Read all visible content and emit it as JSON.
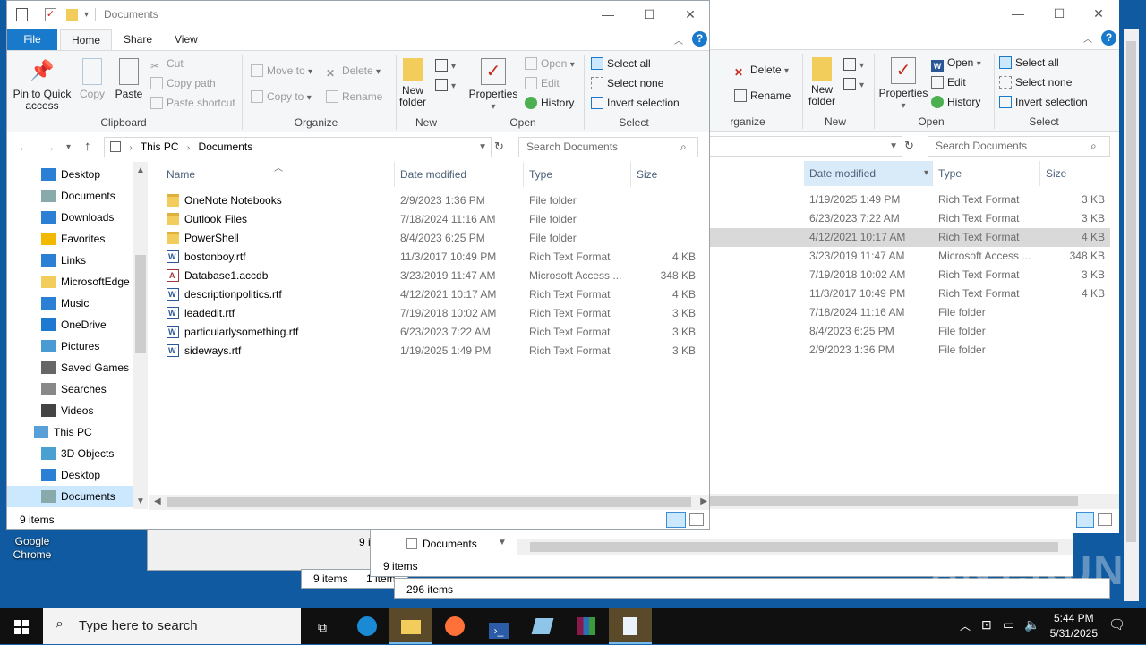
{
  "desktop": {
    "icon_label": "Google Chrome"
  },
  "front": {
    "title": "Documents",
    "tabs": {
      "file": "File",
      "home": "Home",
      "share": "Share",
      "view": "View"
    },
    "ribbon": {
      "pin": "Pin to Quick access",
      "copy": "Copy",
      "paste": "Paste",
      "cut": "Cut",
      "copy_path": "Copy path",
      "paste_shortcut": "Paste shortcut",
      "clipboard": "Clipboard",
      "move_to": "Move to",
      "copy_to": "Copy to",
      "delete": "Delete",
      "rename": "Rename",
      "organize": "Organize",
      "new_folder": "New folder",
      "new": "New",
      "properties": "Properties",
      "open": "Open",
      "edit": "Edit",
      "history": "History",
      "open_group": "Open",
      "select_all": "Select all",
      "select_none": "Select none",
      "invert_selection": "Invert selection",
      "select_group": "Select"
    },
    "breadcrumb": {
      "root": "This PC",
      "current": "Documents"
    },
    "search_placeholder": "Search Documents",
    "nav": [
      {
        "label": "Desktop"
      },
      {
        "label": "Documents"
      },
      {
        "label": "Downloads"
      },
      {
        "label": "Favorites"
      },
      {
        "label": "Links"
      },
      {
        "label": "MicrosoftEdge"
      },
      {
        "label": "Music"
      },
      {
        "label": "OneDrive"
      },
      {
        "label": "Pictures"
      },
      {
        "label": "Saved Games"
      },
      {
        "label": "Searches"
      },
      {
        "label": "Videos"
      },
      {
        "label": "This PC"
      },
      {
        "label": "3D Objects"
      },
      {
        "label": "Desktop"
      },
      {
        "label": "Documents"
      }
    ],
    "columns": {
      "name": "Name",
      "date": "Date modified",
      "type": "Type",
      "size": "Size"
    },
    "files": [
      {
        "name": "OneNote Notebooks",
        "date": "2/9/2023 1:36 PM",
        "type": "File folder",
        "size": "",
        "icon": "folder"
      },
      {
        "name": "Outlook Files",
        "date": "7/18/2024 11:16 AM",
        "type": "File folder",
        "size": "",
        "icon": "folder"
      },
      {
        "name": "PowerShell",
        "date": "8/4/2023 6:25 PM",
        "type": "File folder",
        "size": "",
        "icon": "folder"
      },
      {
        "name": "bostonboy.rtf",
        "date": "11/3/2017 10:49 PM",
        "type": "Rich Text Format",
        "size": "4 KB",
        "icon": "rtf"
      },
      {
        "name": "Database1.accdb",
        "date": "3/23/2019 11:47 AM",
        "type": "Microsoft Access ...",
        "size": "348 KB",
        "icon": "access"
      },
      {
        "name": "descriptionpolitics.rtf",
        "date": "4/12/2021 10:17 AM",
        "type": "Rich Text Format",
        "size": "4 KB",
        "icon": "rtf"
      },
      {
        "name": "leadedit.rtf",
        "date": "7/19/2018 10:02 AM",
        "type": "Rich Text Format",
        "size": "3 KB",
        "icon": "rtf"
      },
      {
        "name": "particularlysomething.rtf",
        "date": "6/23/2023 7:22 AM",
        "type": "Rich Text Format",
        "size": "3 KB",
        "icon": "rtf"
      },
      {
        "name": "sideways.rtf",
        "date": "1/19/2025 1:49 PM",
        "type": "Rich Text Format",
        "size": "3 KB",
        "icon": "rtf"
      }
    ],
    "status": "9 items"
  },
  "back": {
    "ribbon": {
      "delete": "Delete",
      "rename": "Rename",
      "organize": "rganize",
      "new_folder": "New folder",
      "new": "New",
      "properties": "Properties",
      "open": "Open",
      "edit": "Edit",
      "history": "History",
      "open_group": "Open",
      "select_all": "Select all",
      "select_none": "Select none",
      "invert_selection": "Invert selection",
      "select_group": "Select"
    },
    "search_placeholder": "Search Documents",
    "columns": {
      "date": "Date modified",
      "type": "Type",
      "size": "Size"
    },
    "rows": [
      {
        "date": "1/19/2025 1:49 PM",
        "type": "Rich Text Format",
        "size": "3 KB"
      },
      {
        "date": "6/23/2023 7:22 AM",
        "type": "Rich Text Format",
        "size": "3 KB"
      },
      {
        "date": "4/12/2021 10:17 AM",
        "type": "Rich Text Format",
        "size": "4 KB"
      },
      {
        "date": "3/23/2019 11:47 AM",
        "type": "Microsoft Access ...",
        "size": "348 KB"
      },
      {
        "date": "7/19/2018 10:02 AM",
        "type": "Rich Text Format",
        "size": "3 KB"
      },
      {
        "date": "11/3/2017 10:49 PM",
        "type": "Rich Text Format",
        "size": "4 KB"
      },
      {
        "date": "7/18/2024 11:16 AM",
        "type": "File folder",
        "size": ""
      },
      {
        "date": "8/4/2023 6:25 PM",
        "type": "File folder",
        "size": ""
      },
      {
        "date": "2/9/2023 1:36 PM",
        "type": "File folder",
        "size": ""
      }
    ]
  },
  "lower": {
    "crumb": "Documents",
    "status_a": "9 items",
    "status_b": "9 items",
    "status_c": "1 item",
    "status_d": "296 items",
    "status_e": "9 i"
  },
  "taskbar": {
    "search_placeholder": "Type here to search",
    "time": "5:44 PM",
    "date": "5/31/2025"
  },
  "watermark": "ANY.RUN",
  "colors": {
    "accent": "#1979ca",
    "selection": "#cce8ff",
    "taskbar": "#101010"
  }
}
